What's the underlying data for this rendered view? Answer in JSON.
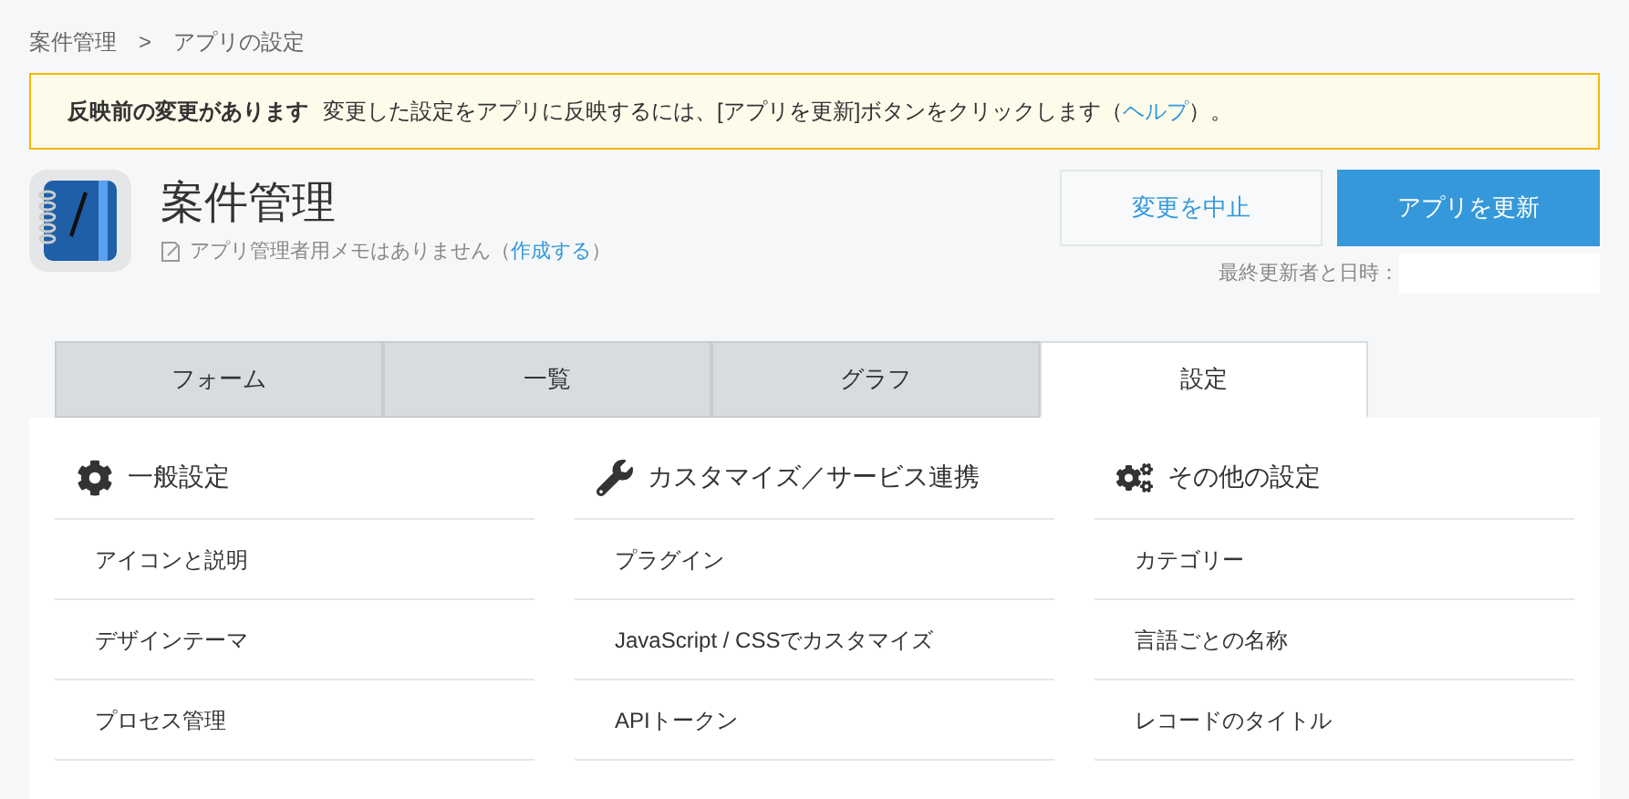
{
  "breadcrumb": [
    "案件管理",
    "アプリの設定"
  ],
  "breadcrumb_separator": ">",
  "notice": {
    "title": "反映前の変更があります",
    "text_before": "変更した設定をアプリに反映するには、[アプリを更新]ボタンをクリックします（",
    "link": "ヘルプ",
    "text_after": "）。"
  },
  "app": {
    "name": "案件管理",
    "memo": "アプリ管理者用メモはありません（",
    "memo_link": "作成する",
    "memo_after": "）"
  },
  "buttons": [
    {
      "label": "変更を中止",
      "kind": "secondary"
    },
    {
      "label": "アプリを更新",
      "kind": "primary"
    }
  ],
  "last_updated_label": "最終更新者と日時：",
  "tabs": [
    {
      "label": "フォーム",
      "selected": false
    },
    {
      "label": "一覧",
      "selected": false
    },
    {
      "label": "グラフ",
      "selected": false
    },
    {
      "label": "設定",
      "selected": true
    }
  ],
  "sections": [
    {
      "title": "一般設定",
      "kind": "gear",
      "items": [
        "アイコンと説明",
        "デザインテーマ",
        "プロセス管理"
      ]
    },
    {
      "title": "カスタマイズ／サービス連携",
      "kind": "wrench",
      "items": [
        "プラグイン",
        "JavaScript / CSSでカスタマイズ",
        "APIトークン"
      ]
    },
    {
      "title": "その他の設定",
      "kind": "gears",
      "items": [
        "カテゴリー",
        "言語ごとの名称",
        "レコードのタイトル"
      ]
    }
  ]
}
